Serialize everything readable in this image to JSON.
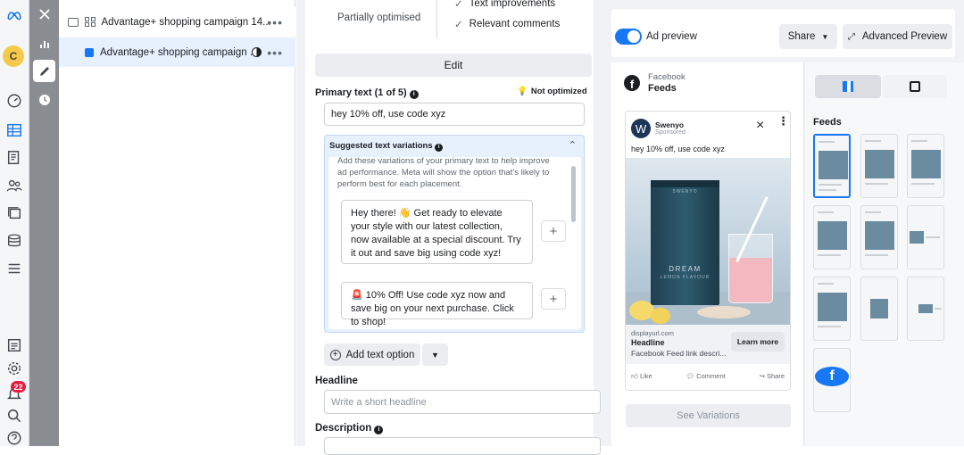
{
  "leftnav": {
    "avatar_letter": "C",
    "notification_count": "22",
    "icons": [
      "meta-logo-icon",
      "dashboard-icon",
      "campaigns-table-icon",
      "pages-icon",
      "audience-icon",
      "ads-stack-icon",
      "billing-icon",
      "menu-icon",
      "reports-icon",
      "settings-icon",
      "notifications-icon",
      "search-icon",
      "help-icon"
    ]
  },
  "tools": {
    "icons": [
      "close-icon",
      "chart-icon",
      "edit-icon",
      "history-icon"
    ]
  },
  "tree": {
    "items": [
      {
        "label": "Advantage+ shopping campaign 14...",
        "more": "•••"
      },
      {
        "label": "Advantage+ shopping campaign ...",
        "more": "•••"
      }
    ]
  },
  "editor": {
    "opt_status": "Partially optimised",
    "checks": [
      "Text improvements",
      "Relevant comments"
    ],
    "edit_label": "Edit",
    "primary_text_label": "Primary text (1 of 5)",
    "not_optimized_label": "Not optimized",
    "primary_text_value": "hey 10% off, use code xyz",
    "suggested_title": "Suggested text variations",
    "suggested_intro": "Add these variations of your primary text to help improve ad performance. Meta will show the option that's likely to perform best for each placement.",
    "suggestions": [
      "Hey there! 👋 Get ready to elevate your style with our latest collection, now available at a special discount. Try it out and save big using code xyz!",
      "🚨 10% Off! Use code xyz now and save big on your next purchase. Click to shop!"
    ],
    "add_text_option": "Add text option",
    "headline_label": "Headline",
    "headline_placeholder": "Write a short headline",
    "description_label": "Description"
  },
  "preview": {
    "ad_preview_label": "Ad preview",
    "share_label": "Share",
    "advanced_preview_label": "Advanced Preview",
    "platform": "Facebook",
    "placement": "Feeds",
    "brand": "Swenyo",
    "sponsored": "Sponsored ·",
    "post_text": "hey 10% off, use code xyz",
    "product_brand": "SWENYO",
    "product_name": "DREAM",
    "product_sub": "LEMON FLAVOUR",
    "display_url": "displayurl.com",
    "headline": "Headline",
    "link_desc": "Facebook Feed link descri...",
    "cta": "Learn more",
    "actions": [
      "Like",
      "Comment",
      "Share"
    ],
    "see_variations": "See Variations",
    "feeds_section": "Feeds"
  },
  "colors": {
    "accent": "#1877f2",
    "toggle_on": "#1877f2"
  }
}
